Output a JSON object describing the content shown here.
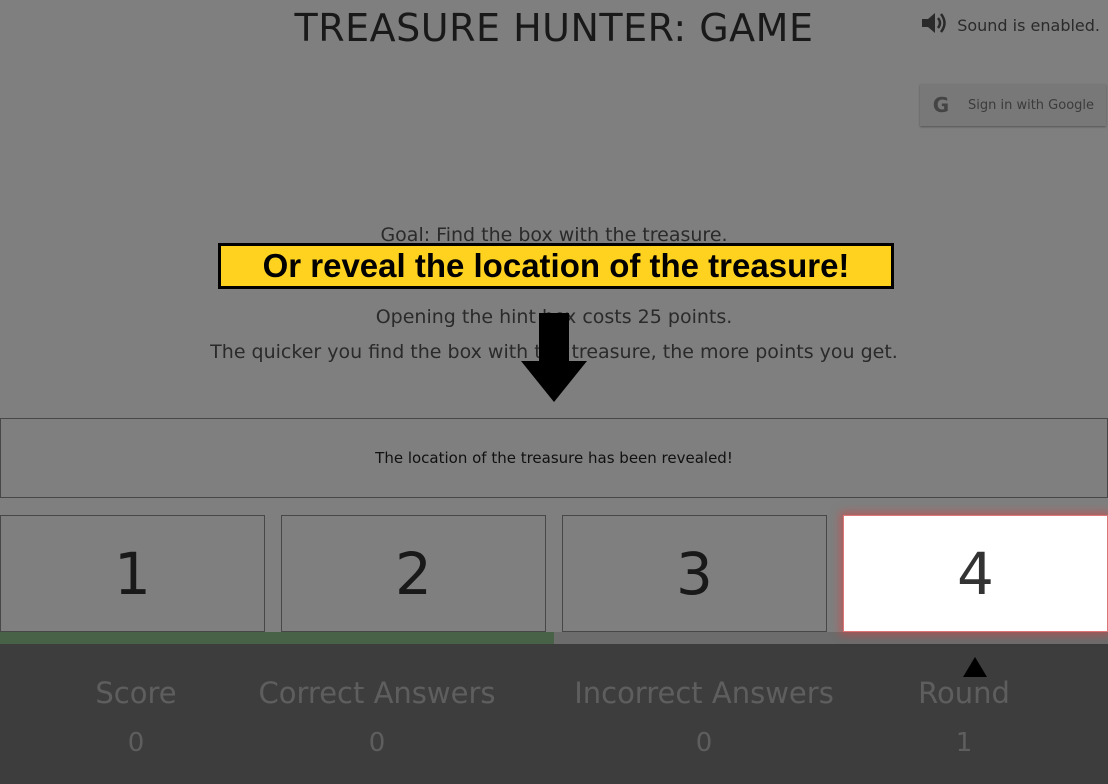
{
  "header": {
    "title": "TREASURE HUNTER: GAME",
    "sound_status": "Sound is enabled.",
    "sound_icon": "speaker-icon",
    "google_signin_label": "Sign in with Google",
    "google_icon": "google-g-icon"
  },
  "instructions": {
    "goal": "Goal: Find the box with the treasure.",
    "hint_cost": "Opening the hint box costs 25 points.",
    "speed_bonus": "The quicker you find the box with the treasure, the more points you get."
  },
  "tutorial": {
    "banner": "Or reveal the location of the treasure!",
    "arrow_down_icon": "arrow-down-icon",
    "arrow_up_icon": "arrow-up-icon",
    "banner_color": "#ffd21f"
  },
  "message": "The location of the treasure has been revealed!",
  "boxes": [
    {
      "label": "1"
    },
    {
      "label": "2"
    },
    {
      "label": "3"
    },
    {
      "label": "4",
      "highlighted": true
    }
  ],
  "timer": {
    "remaining_fraction": 0.5,
    "color": "#8fc58f"
  },
  "stats": {
    "score_label": "Score",
    "score_value": "0",
    "correct_label": "Correct Answers",
    "correct_value": "0",
    "incorrect_label": "Incorrect Answers",
    "incorrect_value": "0",
    "round_label": "Round",
    "round_value": "1"
  }
}
